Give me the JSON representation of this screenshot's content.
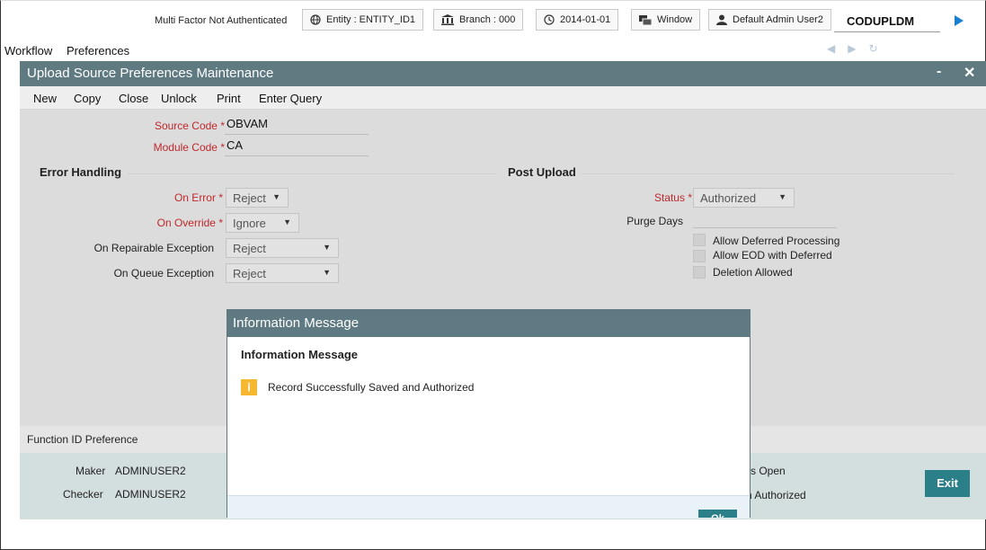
{
  "topbar": {
    "auth_status": "Multi Factor Not Authenticated",
    "entity": "Entity : ENTITY_ID1",
    "branch": "Branch : 000",
    "date": "2014-01-01",
    "window": "Window",
    "user": "Default Admin User2",
    "function_code": "CODUPLDM"
  },
  "menu": {
    "workflow": "Workflow",
    "preferences": "Preferences"
  },
  "window": {
    "title": "Upload Source Preferences Maintenance",
    "minimize": "-",
    "close": "✕"
  },
  "toolbar": {
    "new": "New",
    "copy": "Copy",
    "close": "Close",
    "unlock": "Unlock",
    "print": "Print",
    "enter_query": "Enter Query"
  },
  "form": {
    "source_code_label": "Source Code",
    "source_code_value": "OBVAM",
    "module_code_label": "Module Code",
    "module_code_value": "CA",
    "required_mark": "*",
    "error_handling": {
      "title": "Error Handling",
      "on_error_label": "On Error",
      "on_error_value": "Reject",
      "on_override_label": "On Override",
      "on_override_value": "Ignore",
      "on_repairable_label": "On Repairable Exception",
      "on_repairable_value": "Reject",
      "on_queue_label": "On Queue Exception",
      "on_queue_value": "Reject"
    },
    "post_upload": {
      "title": "Post Upload",
      "status_label": "Status",
      "status_value": "Authorized",
      "purge_days_label": "Purge Days",
      "allow_deferred": "Allow Deferred Processing",
      "allow_eod": "Allow EOD with Deferred",
      "deletion_allowed": "Deletion Allowed"
    },
    "function_id_pref": "Function ID Preference"
  },
  "audit": {
    "maker_label": "Maker",
    "maker_value": "ADMINUSER2",
    "checker_label": "Checker",
    "checker_value": "ADMINUSER2",
    "record_status_partial": "s Open",
    "auth_status_partial": "n Authorized",
    "exit": "Exit"
  },
  "modal": {
    "title": "Information Message",
    "heading": "Information Message",
    "message": "Record Successfully Saved and Authorized",
    "icon": "info-icon",
    "ok_partial": "Ok"
  },
  "colors": {
    "title_bar": "#607a82",
    "accent_button": "#2b7f89",
    "required_label": "#c0282d",
    "info_icon": "#f5b830"
  }
}
